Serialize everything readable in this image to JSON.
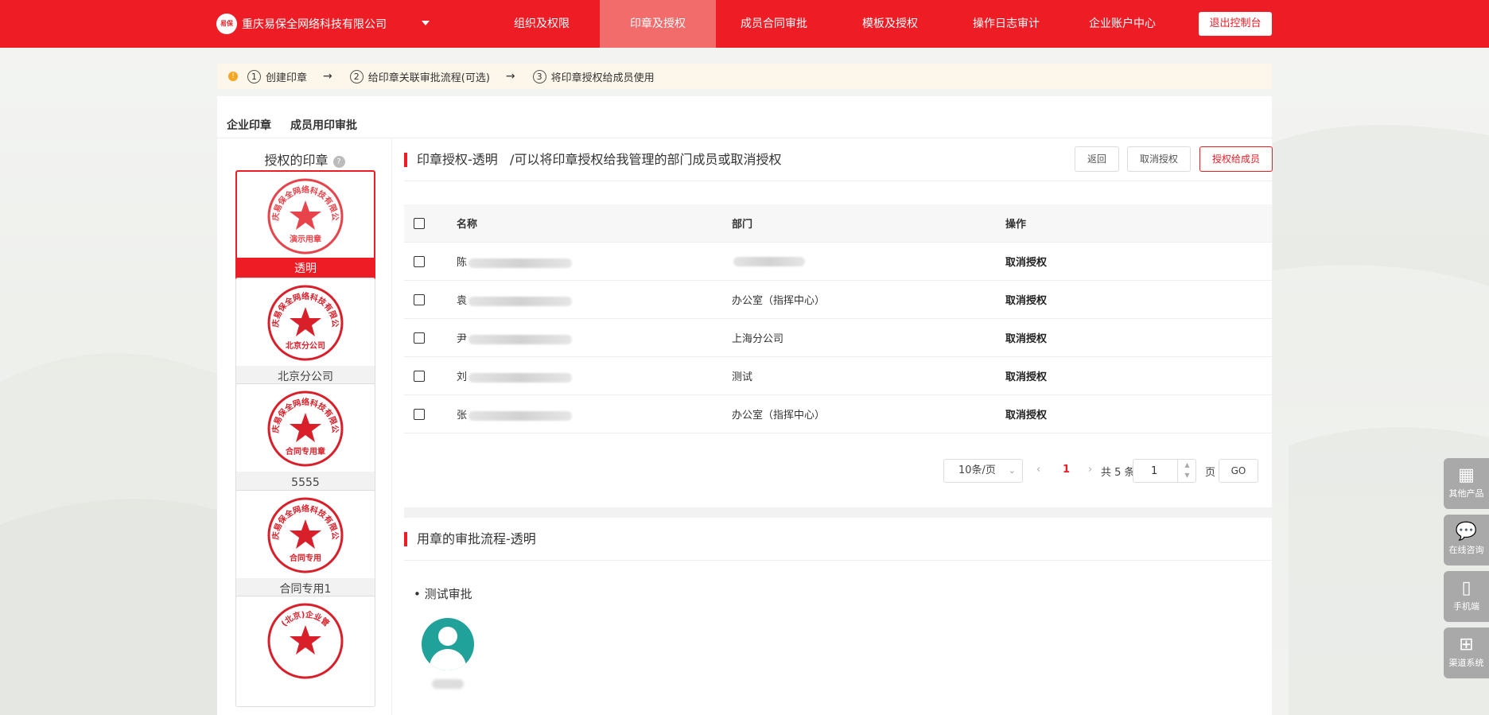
{
  "brand": {
    "logo_text": "易保",
    "company": "重庆易保全网络科技有限公司"
  },
  "nav": [
    {
      "label": "组织及权限"
    },
    {
      "label": "印章及授权"
    },
    {
      "label": "成员合同审批"
    },
    {
      "label": "模板及授权"
    },
    {
      "label": "操作日志审计"
    },
    {
      "label": "企业账户中心"
    }
  ],
  "exit_label": "退出控制台",
  "steps": [
    {
      "num": "1",
      "label": "创建印章"
    },
    {
      "num": "2",
      "label": "给印章关联审批流程(可选)"
    },
    {
      "num": "3",
      "label": "将印章授权给成员使用"
    }
  ],
  "tabs": [
    "企业印章",
    "成员用印审批"
  ],
  "seal_panel": {
    "title": "授权的印章",
    "seals": [
      {
        "name": "透明",
        "seal_top": "重庆易保全网络科技有限公司",
        "seal_bottom": "演示用章",
        "color": "#e8434a"
      },
      {
        "name": "北京分公司",
        "seal_top": "重庆易保全网络科技有限公司",
        "seal_bottom": "北京分公司",
        "color": "#d9202a"
      },
      {
        "name": "5555",
        "seal_top": "重庆易保全网络科技有限公司",
        "seal_bottom": "合同专用章",
        "color": "#d9202a"
      },
      {
        "name": "合同专用1",
        "seal_top": "重庆易保全网络科技有限公司",
        "seal_bottom": "合同专用",
        "color": "#d9202a"
      },
      {
        "name": "",
        "seal_top": "(北京)企业管",
        "seal_bottom": "",
        "color": "#d9202a"
      }
    ]
  },
  "auth_panel": {
    "title": "印章授权-透明",
    "subtitle": "/可以将印章授权给我管理的部门成员或取消授权",
    "btn_back": "返回",
    "btn_cancel": "取消授权",
    "btn_grant": "授权给成员"
  },
  "table": {
    "headers": {
      "name": "名称",
      "dept": "部门",
      "op": "操作"
    },
    "rows": [
      {
        "name_prefix": "陈",
        "dept": "",
        "op": "取消授权"
      },
      {
        "name_prefix": "袁",
        "dept": "办公室（指挥中心）",
        "op": "取消授权"
      },
      {
        "name_prefix": "尹",
        "dept": "上海分公司",
        "op": "取消授权"
      },
      {
        "name_prefix": "刘",
        "dept": "测试",
        "op": "取消授权"
      },
      {
        "name_prefix": "张",
        "dept": "办公室（指挥中心）",
        "op": "取消授权"
      }
    ]
  },
  "pager": {
    "page_size": "10条/页",
    "current": "1",
    "total": "共 5 条",
    "jump_value": "1",
    "unit": "页",
    "go": "GO"
  },
  "flow": {
    "title": "用章的审批流程-透明",
    "item": "• 测试审批"
  },
  "side_tools": [
    {
      "icon": "apps-icon",
      "glyph": "▦",
      "label": "其他产品"
    },
    {
      "icon": "chat-icon",
      "glyph": "💬",
      "label": "在线咨询"
    },
    {
      "icon": "mobile-icon",
      "glyph": "▯",
      "label": "手机端"
    },
    {
      "icon": "org-tree-icon",
      "glyph": "⊞",
      "label": "渠道系统"
    }
  ],
  "colors": {
    "brand_red": "#ee1c25",
    "nav_active": "#f26c6c",
    "teal": "#20a29a"
  }
}
